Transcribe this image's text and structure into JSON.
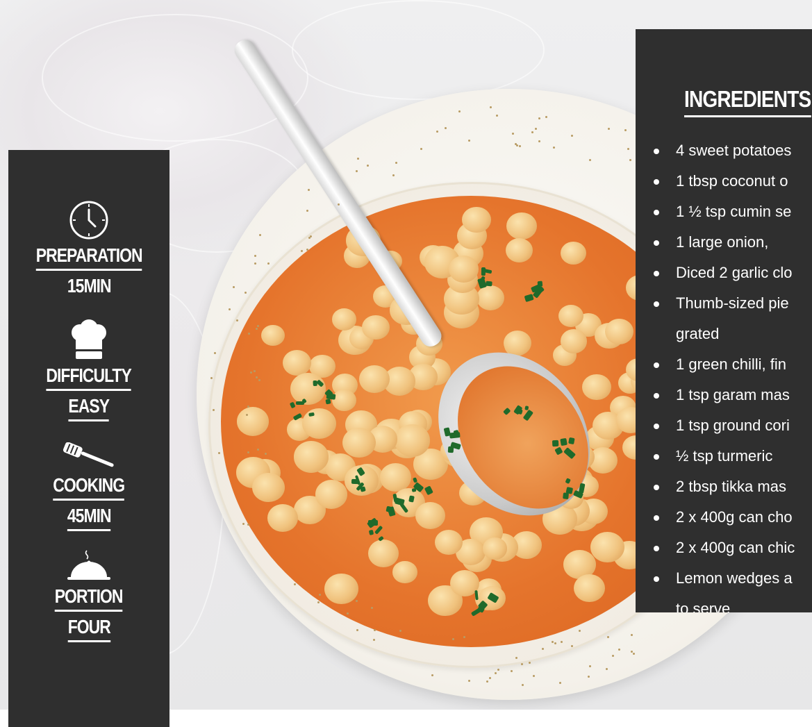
{
  "info_panel": {
    "items": [
      {
        "icon": "clock-icon",
        "label": "PREPARATION",
        "value": "15MIN"
      },
      {
        "icon": "chef-hat-icon",
        "label": "DIFFICULTY",
        "value": "EASY"
      },
      {
        "icon": "spatula-icon",
        "label": "COOKING",
        "value": "45MIN"
      },
      {
        "icon": "cloche-icon",
        "label": "PORTION",
        "value": "FOUR"
      }
    ]
  },
  "ingredients": {
    "title": "INGREDIENTS",
    "items": [
      "4 sweet potatoes",
      "1 tbsp coconut o",
      "1 ½ tsp cumin se",
      "1 large onion,",
      "Diced 2 garlic clo",
      "Thumb-sized pie",
      "grated",
      "1 green chilli, fin",
      "1 tsp garam mas",
      "1 tsp ground cori",
      "½ tsp turmeric",
      "2 tbsp tikka mas",
      "2 x 400g can cho",
      "2 x 400g can chic",
      "Lemon wedges a",
      "to serve"
    ]
  },
  "colors": {
    "panel_bg": "#2f2f2f",
    "panel_text": "#ffffff"
  }
}
